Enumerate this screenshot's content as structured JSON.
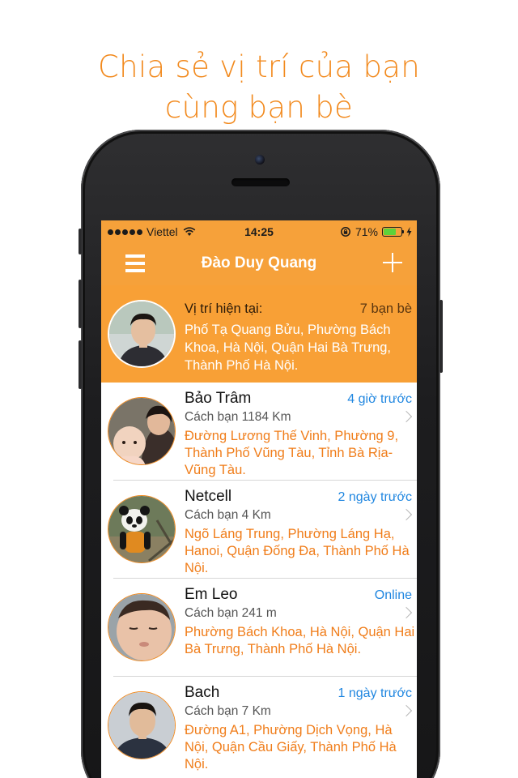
{
  "headline": {
    "line1": "Chia sẻ vị trí của bạn",
    "line2": "cùng bạn bè"
  },
  "statusbar": {
    "carrier": "Viettel",
    "time": "14:25",
    "battery": "71%",
    "battery_level": 0.71
  },
  "navbar": {
    "title": "Đào Duy Quang",
    "menu_icon": "menu-icon",
    "add_icon": "plus-icon"
  },
  "current": {
    "label": "Vị trí hiện tại:",
    "friends_count": "7 bạn bè",
    "address": "Phố Tạ Quang Bửu, Phường Bách Khoa, Hà Nội, Quận Hai Bà Trưng, Thành Phố Hà Nội."
  },
  "friends": [
    {
      "name": "Bảo Trâm",
      "time": "4 giờ trước",
      "distance": "Cách bạn 1184 Km",
      "address": "Đường Lương Thế Vinh, Phường 9, Thành Phố Vũng Tàu, Tỉnh Bà Rịa-Vũng Tàu."
    },
    {
      "name": "Netcell",
      "time": "2 ngày trước",
      "distance": "Cách bạn 4 Km",
      "address": "Ngõ Láng Trung, Phường Láng Hạ, Hanoi, Quận Đống Đa, Thành Phố Hà Nội."
    },
    {
      "name": "Em Leo",
      "time": "Online",
      "distance": "Cách bạn 241 m",
      "address": "Phường Bách Khoa, Hà Nội, Quận Hai Bà Trưng, Thành Phố Hà Nội."
    },
    {
      "name": "Bach",
      "time": "1 ngày trước",
      "distance": "Cách bạn 7 Km",
      "address": "Đường A1, Phường Dịch Vọng, Hà Nội, Quận Cầu Giấy, Thành Phố Hà Nội."
    }
  ],
  "colors": {
    "accent": "#f6a13a",
    "address_orange": "#f07d1a",
    "time_blue": "#1f86e0"
  }
}
